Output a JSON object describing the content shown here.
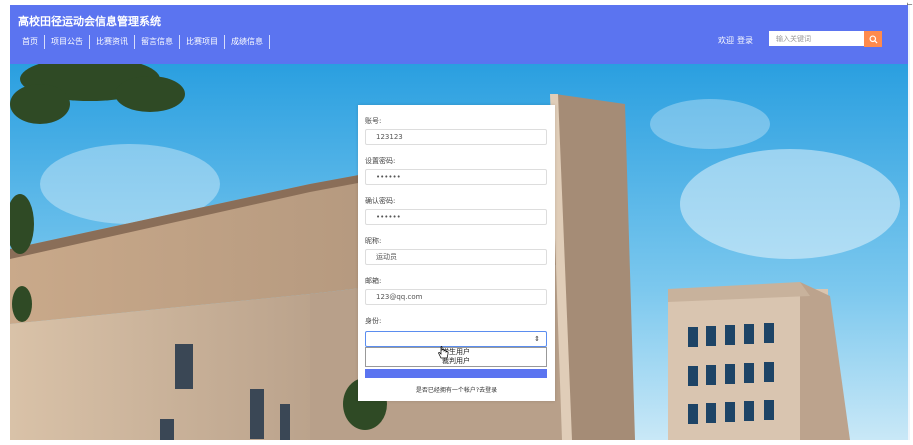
{
  "header": {
    "site_title": "高校田径运动会信息管理系统",
    "nav": [
      "首页",
      "项目公告",
      "比赛资讯",
      "留言信息",
      "比赛项目",
      "成绩信息"
    ],
    "welcome": "欢迎",
    "login": "登录",
    "search_placeholder": "输入关键词"
  },
  "form": {
    "account_label": "账号:",
    "account_value": "123123",
    "password_label": "设置密码:",
    "password_value": "123456",
    "confirm_label": "确认密码:",
    "confirm_value": "123456",
    "nickname_label": "昵称:",
    "nickname_value": "运动员",
    "email_label": "邮箱:",
    "email_value": "123@qq.com",
    "role_label": "身份:",
    "role_options": [
      "学生用户",
      "裁判用户"
    ],
    "login_link": "是否已经拥有一个帐户?去登录"
  },
  "colors": {
    "header": "#5b74f0",
    "search_button": "#ff8a4c"
  },
  "icons": {
    "search": "search-icon",
    "pointer": "hand-cursor-icon"
  }
}
